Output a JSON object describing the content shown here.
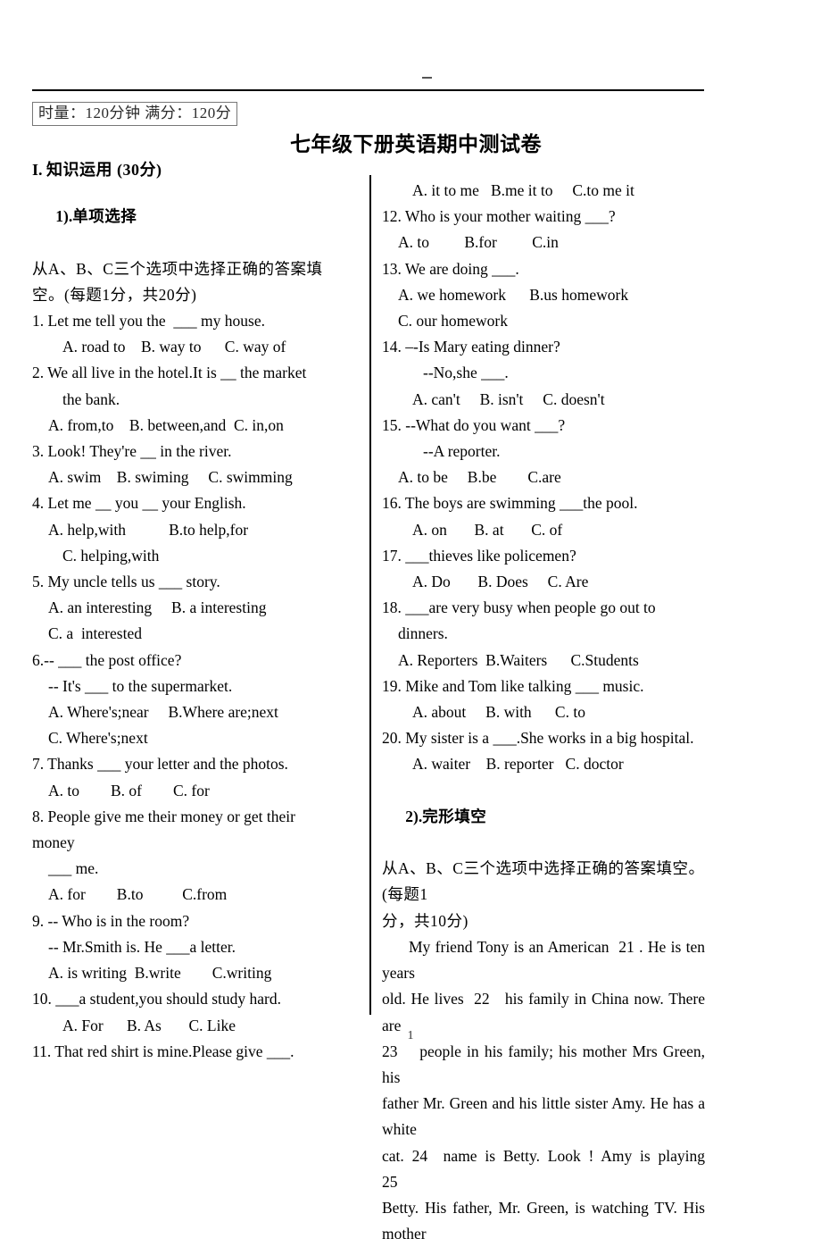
{
  "header": {
    "mark": "",
    "time_score_box": "时量：120分钟    满分：120分",
    "title": "七年级下册英语期中测试卷",
    "section_heading_prefix": "I.",
    "section_heading": "知识运用 (30分)",
    "page_number": "1"
  },
  "part1": {
    "heading_num": "1).",
    "heading_label": "单项选择",
    "instruction_line1": "从A、B、C三个选项中选择正确的答案填",
    "instruction_line2": "空。(每题1分，共20分)"
  },
  "left_column_lines": [
    {
      "indent": 0,
      "text": "1. Let me tell you the  ___ my house."
    },
    {
      "indent": 2,
      "text": "A. road to    B. way to      C. way of"
    },
    {
      "indent": 0,
      "text": "2. We all live in the hotel.It is __ the market"
    },
    {
      "indent": 2,
      "text": "the bank."
    },
    {
      "indent": 1,
      "text": "A. from,to    B. between,and  C. in,on"
    },
    {
      "indent": 0,
      "text": "3. Look! They're __ in the river."
    },
    {
      "indent": 1,
      "text": "A. swim    B. swiming     C. swimming"
    },
    {
      "indent": 0,
      "text": "4. Let me __ you __ your English."
    },
    {
      "indent": 1,
      "text": "A. help,with           B.to help,for"
    },
    {
      "indent": 2,
      "text": "C. helping,with"
    },
    {
      "indent": 0,
      "text": "5. My uncle tells us ___ story."
    },
    {
      "indent": 1,
      "text": "A. an interesting     B. a interesting"
    },
    {
      "indent": 1,
      "text": "C. a  interested"
    },
    {
      "indent": 0,
      "text": "6.-- ___ the post office?"
    },
    {
      "indent": 1,
      "text": "-- It's ___ to the supermarket."
    },
    {
      "indent": 1,
      "text": "A. Where's;near     B.Where are;next"
    },
    {
      "indent": 1,
      "text": "C. Where's;next"
    },
    {
      "indent": 0,
      "text": "7. Thanks ___ your letter and the photos."
    },
    {
      "indent": 1,
      "text": "A. to        B. of        C. for"
    },
    {
      "indent": 0,
      "text": "8. People give me their money or get their"
    },
    {
      "indent": 0,
      "text": "money"
    },
    {
      "indent": 1,
      "text": "___ me."
    },
    {
      "indent": 1,
      "text": "A. for        B.to          C.from"
    },
    {
      "indent": 0,
      "text": "9. -- Who is in the room?"
    },
    {
      "indent": 1,
      "text": "-- Mr.Smith is. He ___a letter."
    },
    {
      "indent": 1,
      "text": "A. is writing  B.write        C.writing"
    },
    {
      "indent": 0,
      "text": "10. ___a student,you should study hard."
    },
    {
      "indent": 2,
      "text": "A. For      B. As       C. Like"
    },
    {
      "indent": 0,
      "text": "11. That red shirt is mine.Please give ___."
    }
  ],
  "right_column_lines": [
    {
      "indent": 2,
      "text": "A. it to me   B.me it to     C.to me it"
    },
    {
      "indent": 0,
      "text": "12. Who is your mother waiting ___?"
    },
    {
      "indent": 1,
      "text": "A. to         B.for         C.in"
    },
    {
      "indent": 0,
      "text": "13. We are doing ___."
    },
    {
      "indent": 1,
      "text": "A. we homework      B.us homework"
    },
    {
      "indent": 1,
      "text": "C. our homework"
    },
    {
      "indent": 0,
      "text": "14. –-Is Mary eating dinner?"
    },
    {
      "indent": 3,
      "text": "--No,she ___."
    },
    {
      "indent": 2,
      "text": "A. can't     B. isn't     C. doesn't"
    },
    {
      "indent": 0,
      "text": "15. --What do you want ___?"
    },
    {
      "indent": 3,
      "text": "--A reporter."
    },
    {
      "indent": 1,
      "text": "A. to be     B.be        C.are"
    },
    {
      "indent": 0,
      "text": "16. The boys are swimming ___the pool."
    },
    {
      "indent": 2,
      "text": "A. on       B. at       C. of"
    },
    {
      "indent": 0,
      "text": "17. ___thieves like policemen?"
    },
    {
      "indent": 2,
      "text": "A. Do       B. Does     C. Are"
    },
    {
      "indent": 0,
      "text": "18. ___are very busy when people go out to"
    },
    {
      "indent": 1,
      "text": "dinners."
    },
    {
      "indent": 1,
      "text": "A. Reporters  B.Waiters      C.Students"
    },
    {
      "indent": 0,
      "text": "19. Mike and Tom like talking ___ music."
    },
    {
      "indent": 2,
      "text": "A. about     B. with      C. to"
    },
    {
      "indent": 0,
      "text": "20. My sister is a ___.She works in a big hospital."
    },
    {
      "indent": 2,
      "text": "A. waiter    B. reporter   C. doctor"
    }
  ],
  "part2": {
    "heading_num": "2).",
    "heading_label": "完形填空",
    "instruction_line1": "从A、B、C三个选项中选择正确的答案填空。(每题1",
    "instruction_line2": "分，共10分)",
    "passage_lines": [
      "My friend Tony is an American  21 . He is ten years",
      "old. He lives  22   his family in China now. There are",
      "23    people in his family; his mother Mrs Green, his",
      "father Mr. Green and his little sister Amy. He has a white",
      "cat. 24  name is Betty. Look ! Amy is playing       25",
      "Betty. His father, Mr. Green, is watching TV. His mother"
    ]
  }
}
